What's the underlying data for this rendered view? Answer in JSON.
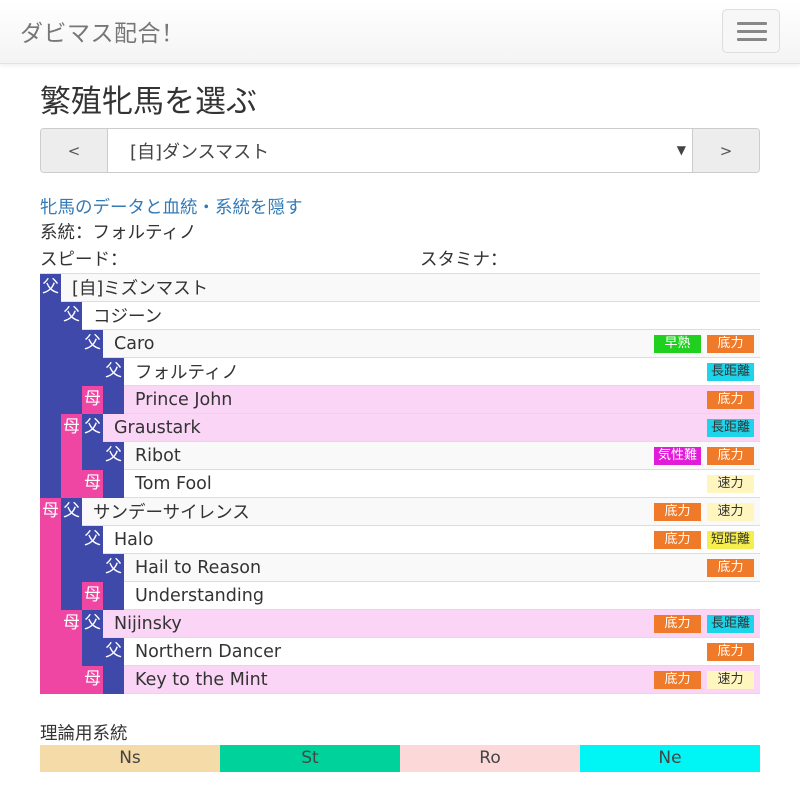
{
  "app": {
    "brand": "ダビマス配合！",
    "menu_icon": "hamburger-icon"
  },
  "page": {
    "title": "繁殖牝馬を選ぶ"
  },
  "selector": {
    "prev_label": "<",
    "next_label": ">",
    "selected": "[自]ダンスマスト",
    "caret": "▼"
  },
  "info": {
    "toggle_link": "牝馬のデータと血統・系統を隠す",
    "lineage": "系統：フォルティノ",
    "speed_label": "スピード：",
    "stamina_label": "スタミナ："
  },
  "labels": {
    "sire": "父",
    "dam": "母"
  },
  "pedigree": [
    {
      "name": "[自]ミズンマスト",
      "tags": []
    },
    {
      "name": "コジーン",
      "tags": []
    },
    {
      "name": "Caro",
      "tags": [
        {
          "label": "早熟",
          "type": "souzyuku"
        },
        {
          "label": "底力",
          "type": "tokoryoku"
        }
      ]
    },
    {
      "name": "フォルティノ",
      "tags": [
        {
          "label": "長距離",
          "type": "choukyori"
        }
      ]
    },
    {
      "name": "Prince John",
      "tags": [
        {
          "label": "底力",
          "type": "tokoryoku"
        }
      ]
    },
    {
      "name": "Graustark",
      "tags": [
        {
          "label": "長距離",
          "type": "choukyori"
        }
      ]
    },
    {
      "name": "Ribot",
      "tags": [
        {
          "label": "気性難",
          "type": "kisyounan"
        },
        {
          "label": "底力",
          "type": "tokoryoku"
        }
      ]
    },
    {
      "name": "Tom Fool",
      "tags": [
        {
          "label": "速力",
          "type": "sokuryoku"
        }
      ]
    },
    {
      "name": "サンデーサイレンス",
      "tags": [
        {
          "label": "底力",
          "type": "tokoryoku"
        },
        {
          "label": "速力",
          "type": "sokuryoku"
        }
      ]
    },
    {
      "name": "Halo",
      "tags": [
        {
          "label": "底力",
          "type": "tokoryoku"
        },
        {
          "label": "短距離",
          "type": "tankyori"
        }
      ]
    },
    {
      "name": "Hail to Reason",
      "tags": [
        {
          "label": "底力",
          "type": "tokoryoku"
        }
      ]
    },
    {
      "name": "Understanding",
      "tags": []
    },
    {
      "name": "Nijinsky",
      "tags": [
        {
          "label": "底力",
          "type": "tokoryoku"
        },
        {
          "label": "長距離",
          "type": "choukyori"
        }
      ]
    },
    {
      "name": "Northern Dancer",
      "tags": [
        {
          "label": "底力",
          "type": "tokoryoku"
        }
      ]
    },
    {
      "name": "Key to the Mint",
      "tags": [
        {
          "label": "底力",
          "type": "tokoryoku"
        },
        {
          "label": "速力",
          "type": "sokuryoku"
        }
      ]
    }
  ],
  "theory": {
    "label": "理論用系統",
    "segments": [
      {
        "label": "Ns",
        "color": "#f5dba8"
      },
      {
        "label": "St",
        "color": "#00d29c"
      },
      {
        "label": "Ro",
        "color": "#fcd8d8"
      },
      {
        "label": "Ne",
        "color": "#00f5f5"
      }
    ]
  }
}
